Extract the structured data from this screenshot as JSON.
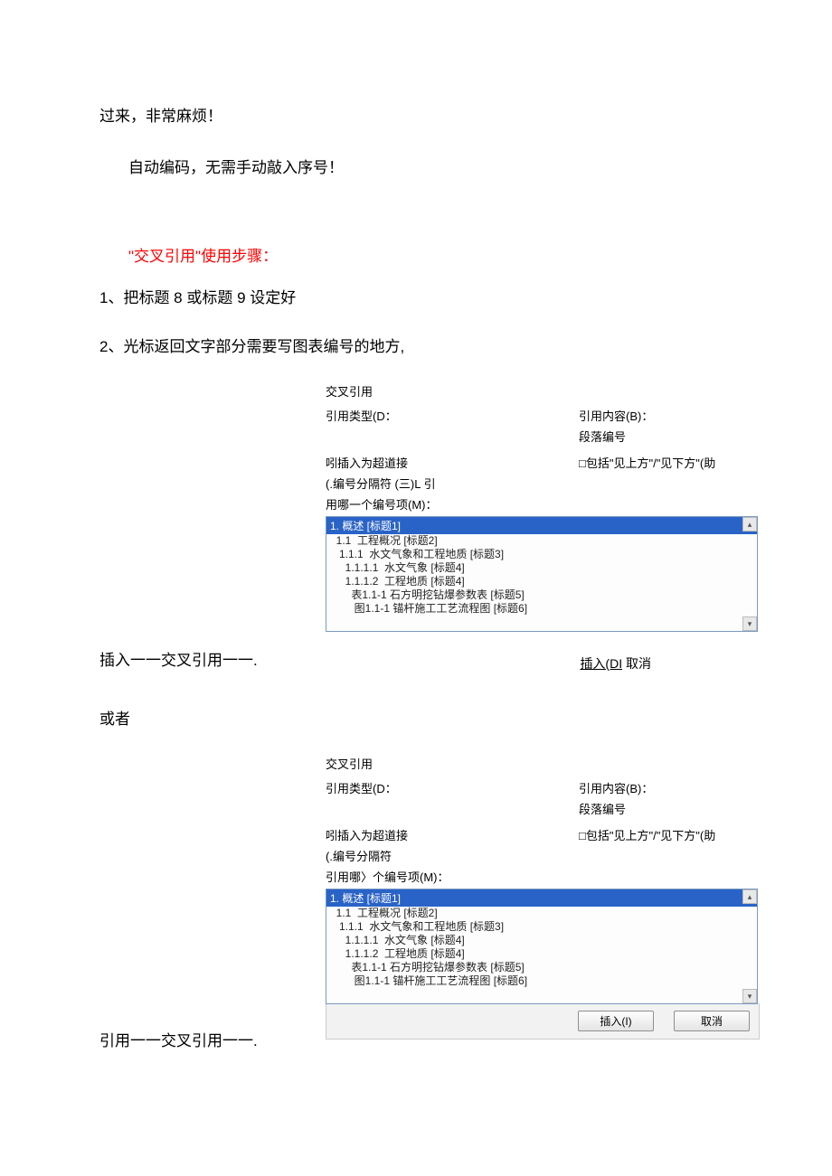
{
  "text": {
    "line1": "过来，非常麻烦！",
    "line2": "自动编码，无需手动敲入序号！",
    "heading_steps": "\"交叉引用\"使用步骤：",
    "step1": "1、把标题 8 或标题 9 设定好",
    "step2": "2、光标返回文字部分需要写图表编号的地方,",
    "caption1": "插入一一交叉引用一一.",
    "or": "或者",
    "caption2": "引用一一交叉引用一一."
  },
  "dialog1": {
    "title": "交叉引用",
    "ref_type_label": "引用类型(D：",
    "ref_content_label": "引用内容(B)：",
    "ref_content_value": "段落编号",
    "insert_hyperlink": "吲插入为超道接",
    "include_above_below": "□包括\"见上方\"/\"见下方\"(助",
    "separator_note": "(.编号分隔符 (三)L 引",
    "which_item": "用哪一个编号项(M)：",
    "selected": "1.  概述 [标题1]",
    "items": [
      "  1.1  工程概况 [标题2]",
      "   1.1.1  水文气象和工程地质 [标题3]",
      "     1.1.1.1  水文气象 [标题4]",
      "     1.1.1.2  工程地质 [标题4]",
      "       表1.1-1 石方明挖钻爆参数表 [标题5]",
      "        图1.1-1 锚杆施工工艺流程图 [标题6]"
    ],
    "insert_btn": "插入(DI",
    "cancel_btn": "取消"
  },
  "dialog2": {
    "title": "交叉引用",
    "ref_type_label": "引用类型(D：",
    "ref_content_label": "引用内容(B)：",
    "ref_content_value": "段落编号",
    "insert_hyperlink": "吲插入为超道接",
    "include_above_below": "□包括\"见上方\"/\"见下方\"(助",
    "separator_note": "(.编号分隔符",
    "which_item": "引用哪〉个编号项(M)：",
    "selected": "1.  概述 [标题1]",
    "items": [
      "  1.1  工程概况 [标题2]",
      "   1.1.1  水文气象和工程地质 [标题3]",
      "     1.1.1.1  水文气象 [标题4]",
      "     1.1.1.2  工程地质 [标题4]",
      "       表1.1-1 石方明挖钻爆参数表 [标题5]",
      "        图1.1-1 锚杆施工工艺流程图 [标题6]"
    ],
    "insert_btn": "插入(I)",
    "cancel_btn": "取消"
  }
}
